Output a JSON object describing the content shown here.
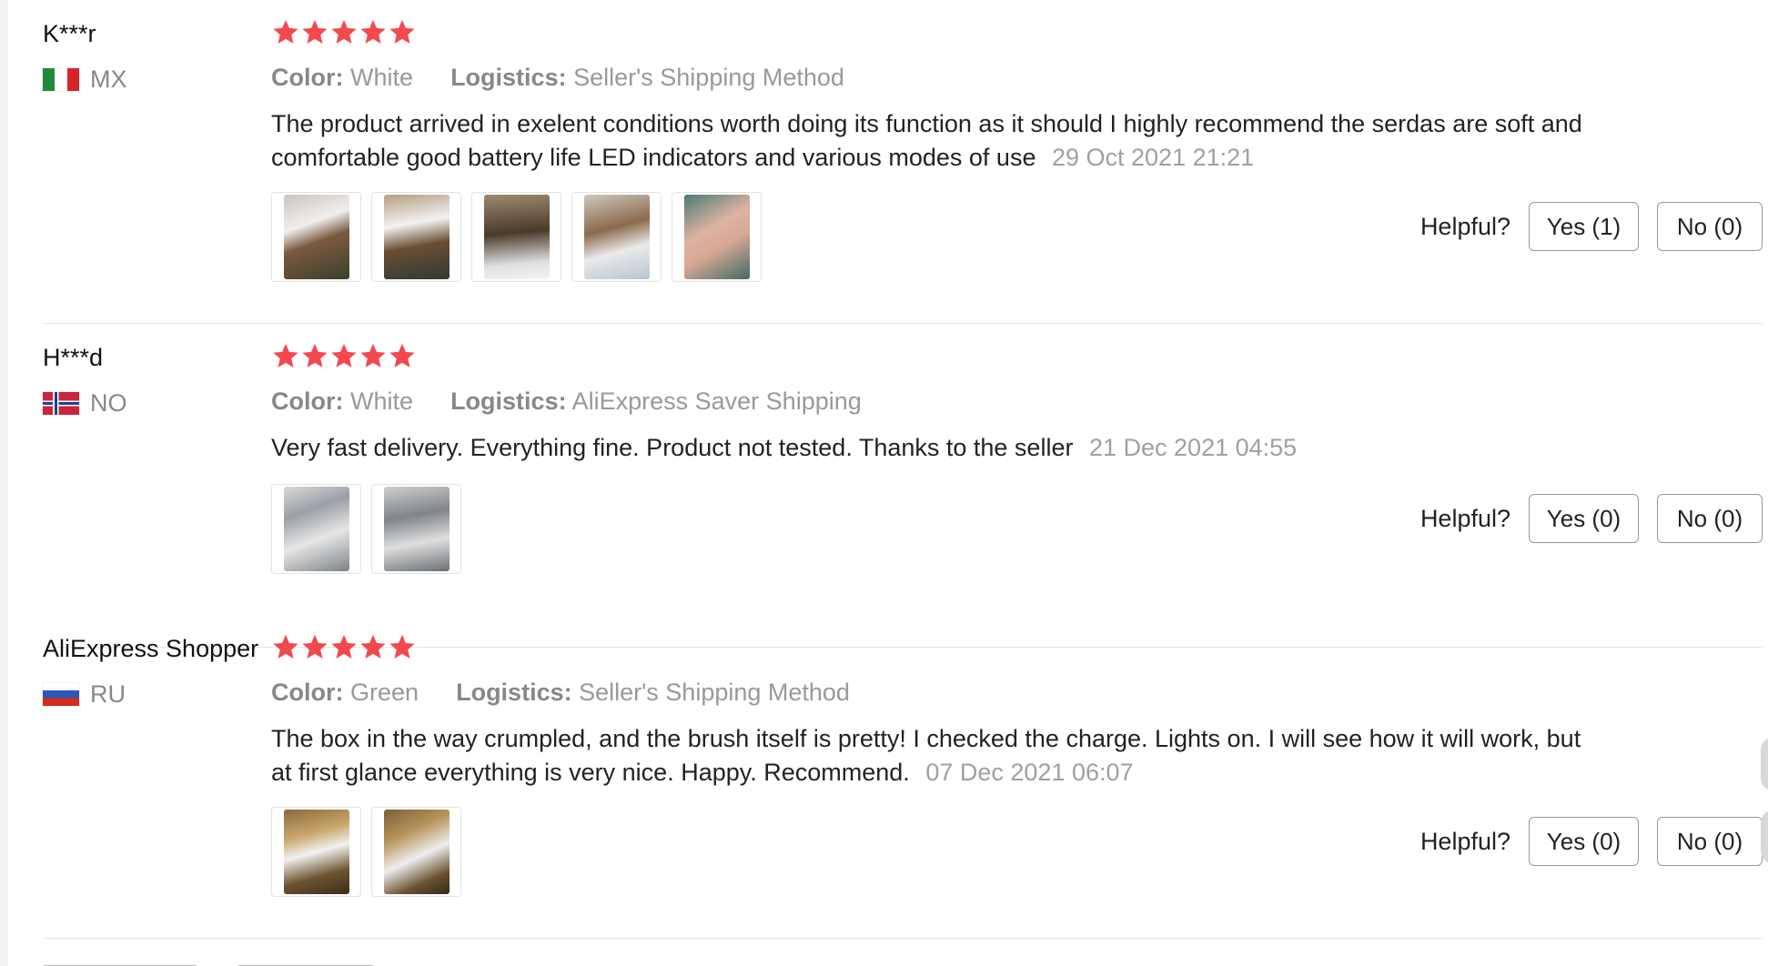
{
  "colors": {
    "star": "#f2494f",
    "meta_gray": "#999999",
    "date_gray": "#a0a0a0",
    "border": "#e6e6e6"
  },
  "labels": {
    "color": "Color:",
    "logistics": "Logistics:",
    "helpful": "Helpful?"
  },
  "reviews": [
    {
      "user": "K***r",
      "country_code": "MX",
      "flag": "mexico-flag",
      "rating": 5,
      "color": "White",
      "logistics": "Seller's Shipping Method",
      "text": "The product arrived in exelent conditions worth doing its function as it should I highly recommend the serdas are soft and comfortable good battery life LED indicators and various modes of use",
      "date": "29 Oct 2021 21:21",
      "photo_count": 5,
      "yes": "Yes (1)",
      "no": "No (0)"
    },
    {
      "user": "H***d",
      "country_code": "NO",
      "flag": "norway-flag",
      "rating": 5,
      "color": "White",
      "logistics": "AliExpress Saver Shipping",
      "text": "Very fast delivery. Everything fine. Product not tested. Thanks to the seller",
      "date": "21 Dec 2021 04:55",
      "photo_count": 2,
      "yes": "Yes (0)",
      "no": "No (0)"
    },
    {
      "user": "AliExpress Shopper",
      "country_code": "RU",
      "flag": "russia-flag",
      "rating": 5,
      "color": "Green",
      "logistics": "Seller's Shipping Method",
      "text": "The box in the way crumpled, and the brush itself is pretty! I checked the charge. Lights on. I will see how it will work, but at first glance everything is very nice. Happy. Recommend.",
      "date": "07 Dec 2021 06:07",
      "photo_count": 2,
      "yes": "Yes (0)",
      "no": "No (0)"
    }
  ]
}
